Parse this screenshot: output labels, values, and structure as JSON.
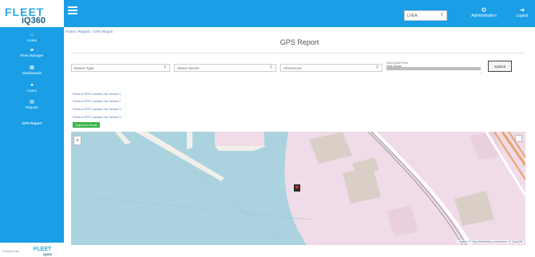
{
  "logo": {
    "line1": "FLEET",
    "line2": "iQ360"
  },
  "topbar": {
    "company_select": "LVEA",
    "admin_label": "Administration",
    "logout_label": "Logout"
  },
  "sidebar": {
    "items": [
      {
        "label": "Home",
        "icon": "home-icon"
      },
      {
        "label": "Fleet Manager",
        "icon": "truck-icon"
      },
      {
        "label": "Dashboards",
        "icon": "dashboard-icon"
      },
      {
        "label": "Users",
        "icon": "user-icon"
      },
      {
        "label": "Reports",
        "icon": "report-icon"
      },
      {
        "label": "GPS Report",
        "icon": "gps-icon"
      }
    ]
  },
  "main": {
    "breadcrumb": "Home / Reports / GPS Report",
    "title": "GPS Report"
  },
  "filters": {
    "device_type": "Device Type",
    "device_select": "Select Device",
    "all_devices": "All Devices",
    "date_label": "Select Date/Time",
    "date_value": "Date Range",
    "submit": "Submit"
  },
  "links": [
    "Recent GPS Location for device 1",
    "Recent GPS Location for device 2",
    "Recent GPS Location for device 3",
    "Recent GPS Location for device 4"
  ],
  "export_button": "Export to Excel",
  "map": {
    "zoom_in": "+",
    "attribution": "Leaflet | © OpenStreetMap contributors, © CartoDB"
  },
  "footer": {
    "copyright": "Powered by",
    "logo1": "FLEET",
    "logo2": "iQ360"
  },
  "colors": {
    "primary": "#1a9ee6",
    "water": "#aad3df",
    "land_pink": "#f2dbe9",
    "green_button": "#3bb54a"
  }
}
